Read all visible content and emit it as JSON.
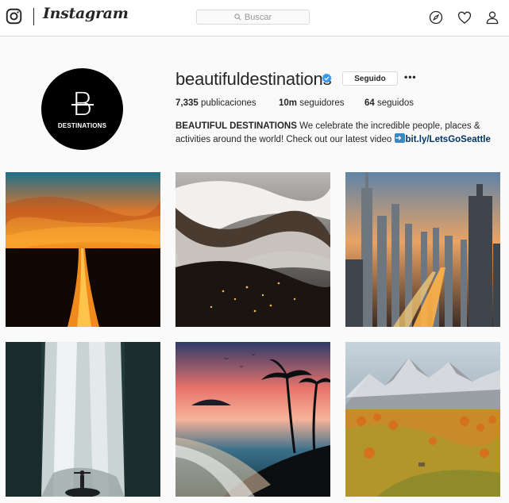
{
  "header": {
    "brand": "Instagram",
    "search_placeholder": "Buscar",
    "icons": [
      "instagram-glyph-icon",
      "compass-icon",
      "heart-icon",
      "profile-icon"
    ]
  },
  "profile": {
    "username": "beautifuldestinations",
    "verified": true,
    "follow_button": "Seguido",
    "more_label": "•••",
    "avatar_letter": "B",
    "avatar_text": "DESTINATIONS",
    "stats": {
      "posts_count": "7,335",
      "posts_label": "publicaciones",
      "followers_count": "10m",
      "followers_label": "seguidores",
      "following_count": "64",
      "following_label": "seguidos"
    },
    "bio": {
      "name": "BEAUTIFUL DESTINATIONS",
      "text": " We celebrate the incredible people, places & activities around the world! Check out our latest video ",
      "link": "bit.ly/LetsGoSeattle"
    }
  },
  "posts": [
    {
      "subject": "sunset over river"
    },
    {
      "subject": "fog over mountains at dusk"
    },
    {
      "subject": "city skyline at sunset"
    },
    {
      "subject": "waterfall with person"
    },
    {
      "subject": "tropical beach at sunset"
    },
    {
      "subject": "autumn mountains and meadow"
    }
  ],
  "colors": {
    "accent_link": "#003569",
    "verified_blue": "#3897f0",
    "border": "#dbdbdb",
    "background": "#fafafa"
  }
}
